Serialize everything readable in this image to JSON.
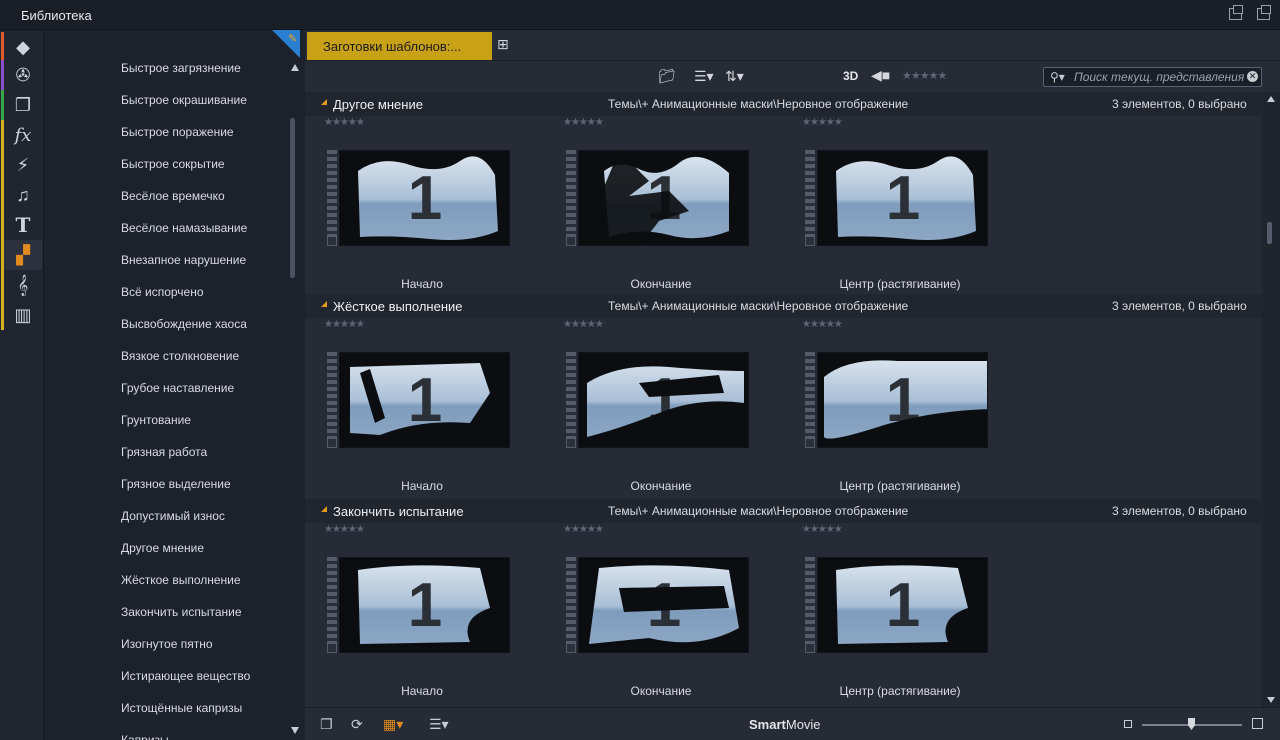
{
  "window": {
    "title": "Библиотека"
  },
  "sidebar_icons": [
    {
      "name": "projects-icon",
      "glyph": "◆",
      "color": "#e05a2a"
    },
    {
      "name": "film-reel-icon",
      "glyph": "✇",
      "color": "#8a4fc8"
    },
    {
      "name": "photos-icon",
      "glyph": "❐",
      "color": "#37a84a"
    },
    {
      "name": "effects-icon",
      "glyph": "fx",
      "color": "#d6b21a"
    },
    {
      "name": "transitions-icon",
      "glyph": "⚡",
      "color": "#d6b21a"
    },
    {
      "name": "music-icon",
      "glyph": "♫",
      "color": "#d6b21a"
    },
    {
      "name": "title-icon",
      "glyph": "T",
      "color": "#d6b21a"
    },
    {
      "name": "templates-icon",
      "glyph": "▞",
      "color": "#d6b21a"
    },
    {
      "name": "scorefitter-icon",
      "glyph": "𝄞",
      "color": "#d6b21a"
    },
    {
      "name": "piano-icon",
      "glyph": "▥",
      "color": "#d6b21a"
    }
  ],
  "categories": [
    "Быстрое загрязнение",
    "Быстрое окрашивание",
    "Быстрое поражение",
    "Быстрое сокрытие",
    "Весёлое времечко",
    "Весёлое намазывание",
    "Внезапное нарушение",
    "Всё испорчено",
    "Высвобождение хаоса",
    "Вязкое столкновение",
    "Грубое наставление",
    "Грунтование",
    "Грязная работа",
    "Грязное выделение",
    "Допустимый износ",
    "Другое мнение",
    "Жёсткое выполнение",
    "Закончить испытание",
    "Изогнутое пятно",
    "Истирающее вещество",
    "Истощённые капризы",
    "Капризы"
  ],
  "tab": {
    "label": "Заготовки шаблонов:..."
  },
  "toolbar": {
    "label_3d": "3D",
    "search_placeholder": "Поиск текущ. представления",
    "rating": 0
  },
  "groups": [
    {
      "name": "Другое мнение",
      "path": "Темы\\+ Анимационные маски\\Неровное отображение",
      "count": "3 элементов, 0 выбрано",
      "items": [
        {
          "label": "Начало",
          "rating": 0
        },
        {
          "label": "Окончание",
          "rating": 0
        },
        {
          "label": "Центр (растягивание)",
          "rating": 0
        }
      ]
    },
    {
      "name": "Жёсткое выполнение",
      "path": "Темы\\+ Анимационные маски\\Неровное отображение",
      "count": "3 элементов, 0 выбрано",
      "items": [
        {
          "label": "Начало",
          "rating": 0
        },
        {
          "label": "Окончание",
          "rating": 0
        },
        {
          "label": "Центр (растягивание)",
          "rating": 0
        }
      ]
    },
    {
      "name": "Закончить испытание",
      "path": "Темы\\+ Анимационные маски\\Неровное отображение",
      "count": "3 элементов, 0 выбрано",
      "items": [
        {
          "label": "Начало",
          "rating": 0
        },
        {
          "label": "Окончание",
          "rating": 0
        },
        {
          "label": "Центр (растягивание)",
          "rating": 0
        }
      ]
    }
  ],
  "thumb_digit": "1",
  "bottombar": {
    "smart_bold": "Smart",
    "smart_rest": "Movie"
  },
  "colors": {
    "tab_accent": "#c9a116",
    "group_triangle": "#e39b1c",
    "active_view": "#e08a1e"
  }
}
